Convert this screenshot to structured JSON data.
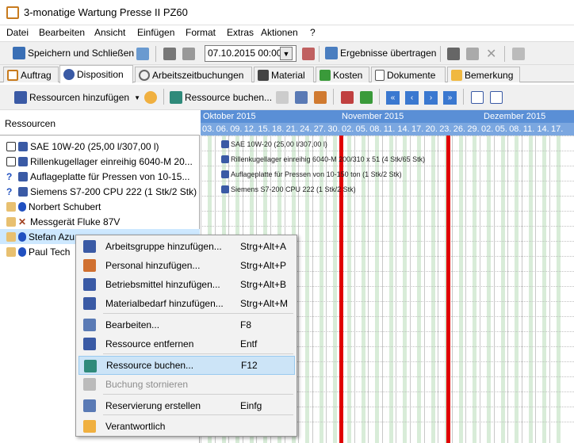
{
  "window": {
    "title": "3-monatige Wartung Presse II PZ60"
  },
  "menu": [
    "Datei",
    "Bearbeiten",
    "Ansicht",
    "Einfügen",
    "Format",
    "Extras",
    "Aktionen",
    "?"
  ],
  "toolbar1": {
    "save_close": "Speichern und Schließen",
    "date_value": "07.10.2015 00:00",
    "transfer": "Ergebnisse übertragen"
  },
  "tabs": [
    "Auftrag",
    "Disposition",
    "Arbeitszeitbuchungen",
    "Material",
    "Kosten",
    "Dokumente",
    "Bemerkung"
  ],
  "toolbar2": {
    "add_resources": "Ressourcen hinzufügen",
    "book_resource": "Ressource buchen..."
  },
  "resources": {
    "header": "Ressourcen",
    "rows": [
      "SAE 10W-20 (25,00 l/307,00 l)",
      "Rillenkugellager einreihig 6040-M 20...",
      "Auflageplatte für Pressen von 10-15...",
      "Siemens S7-200 CPU 222 (1 Stk/2 Stk)",
      "Norbert Schubert",
      "Messgerät Fluke 87V",
      "Stefan Azu",
      "Paul Tech"
    ]
  },
  "gantt": {
    "months": [
      "Oktober 2015",
      "November 2015",
      "Dezember 2015"
    ],
    "days": [
      "03.",
      "06.",
      "09.",
      "12.",
      "15.",
      "18.",
      "21.",
      "24.",
      "27.",
      "30.",
      "02.",
      "05.",
      "08.",
      "11.",
      "14.",
      "17.",
      "20.",
      "23.",
      "26.",
      "29.",
      "02.",
      "05.",
      "08.",
      "11.",
      "14.",
      "17."
    ],
    "bars": [
      "SAE 10W-20 (25,00 l/307,00 l)",
      "Rillenkugellager einreihig 6040-M 200/310 x 51 (4 Stk/65 Stk)",
      "Auflageplatte für Pressen von 10-150 ton (1 Stk/2 Stk)",
      "Siemens S7-200 CPU 222 (1 Stk/2 Stk)"
    ]
  },
  "context_menu": [
    {
      "label": "Arbeitsgruppe hinzufügen...",
      "shortcut": "Strg+Alt+A",
      "icon": "workgroup-icon"
    },
    {
      "label": "Personal hinzufügen...",
      "shortcut": "Strg+Alt+P",
      "icon": "person-add-icon"
    },
    {
      "label": "Betriebsmittel hinzufügen...",
      "shortcut": "Strg+Alt+B",
      "icon": "equipment-icon"
    },
    {
      "label": "Materialbedarf hinzufügen...",
      "shortcut": "Strg+Alt+M",
      "icon": "material-icon"
    },
    {
      "label": "Bearbeiten...",
      "shortcut": "F8",
      "icon": "edit-icon"
    },
    {
      "label": "Ressource entfernen",
      "shortcut": "Entf",
      "icon": "remove-icon"
    },
    {
      "label": "Ressource buchen...",
      "shortcut": "F12",
      "icon": "book-icon"
    },
    {
      "label": "Buchung stornieren",
      "shortcut": "",
      "icon": "cancel-booking-icon"
    },
    {
      "label": "Reservierung erstellen",
      "shortcut": "Einfg",
      "icon": "reservation-icon"
    },
    {
      "label": "Verantwortlich",
      "shortcut": "",
      "icon": "responsible-icon"
    }
  ],
  "colors": {
    "accent": "#5a8fd6",
    "today_line": "#e00000",
    "highlight": "#cce4f7"
  }
}
